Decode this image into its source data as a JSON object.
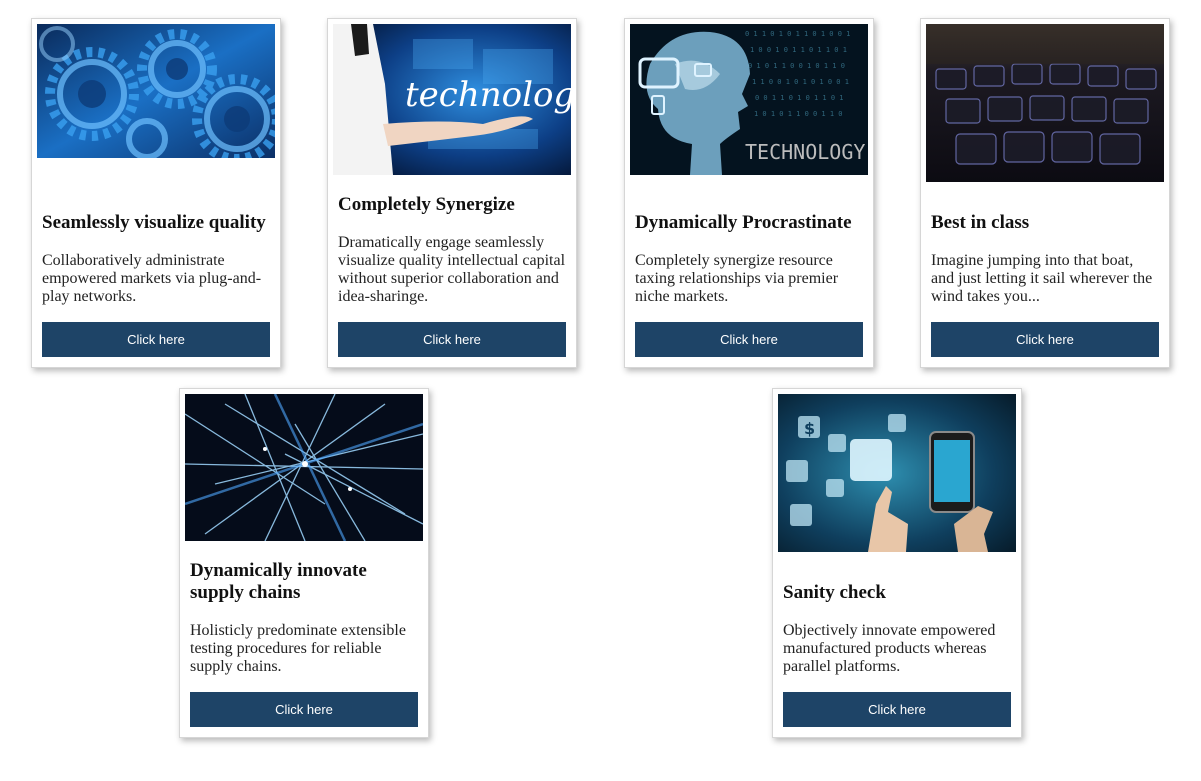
{
  "cards": [
    {
      "title": "Seamlessly visualize quality",
      "description": "Collaboratively administrate empowered markets via plug-and-play networks.",
      "button_label": "Click here",
      "image": "gears-image"
    },
    {
      "title": "Completely Synergize",
      "description": "Dramatically engage seamlessly visualize quality intellectual capital without superior collaboration and idea-sharinge.",
      "button_label": "Click here",
      "image": "technology-hand-image",
      "image_text": "technology"
    },
    {
      "title": "Dynamically Procrastinate",
      "description": "Completely synergize resource taxing relationships via premier niche markets.",
      "button_label": "Click here",
      "image": "ai-head-image",
      "image_text": "TECHNOLOGY"
    },
    {
      "title": "Best in class",
      "description": "Imagine jumping into that boat, and just letting it sail wherever the wind takes you...",
      "button_label": "Click here",
      "image": "keyboard-image"
    },
    {
      "title": "Dynamically innovate supply chains",
      "description": "Holisticly predominate extensible testing procedures for reliable supply chains.",
      "button_label": "Click here",
      "image": "network-lines-image"
    },
    {
      "title": "Sanity check",
      "description": "Objectively innovate empowered manufactured products whereas parallel platforms.",
      "button_label": "Click here",
      "image": "smartphone-apps-image",
      "image_text": "$"
    }
  ],
  "colors": {
    "button_bg": "#1e4467",
    "button_text": "#ffffff",
    "card_border": "#d6d6d6"
  }
}
